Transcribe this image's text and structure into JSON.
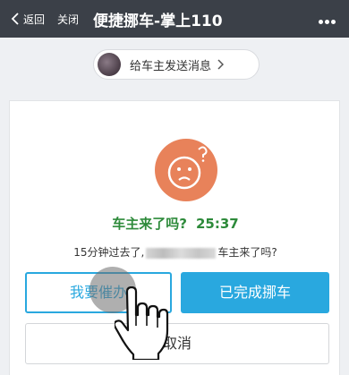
{
  "topbar": {
    "back_label": "返回",
    "close_label": "关闭",
    "title": "便捷挪车-掌上110"
  },
  "message": {
    "label": "给车主发送消息"
  },
  "prompt": {
    "question": "车主来了吗?",
    "timer": "25:37",
    "subtext_before": "15分钟过去了,",
    "subtext_after": "车主来了吗?"
  },
  "buttons": {
    "urge": "我要催办",
    "done": "已完成挪车",
    "cancel": "取消"
  },
  "colors": {
    "topbar": "#3b4048",
    "accent": "#29a8df",
    "face": "#e8825a",
    "question_green": "#2d8a3a"
  },
  "icons": [
    "back-chevron-icon",
    "more-dots-icon",
    "chevron-right-icon",
    "sad-face-icon",
    "hand-pointer-icon"
  ]
}
